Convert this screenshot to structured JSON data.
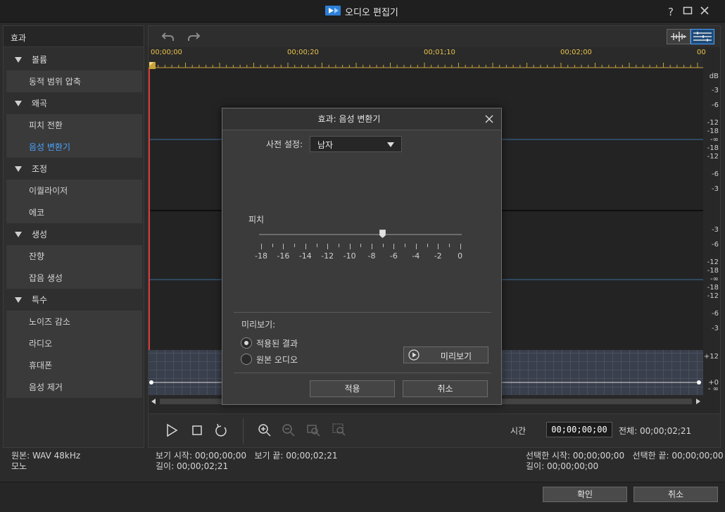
{
  "app": {
    "title": "오디오 편집기",
    "window_buttons": {
      "help": "?"
    }
  },
  "effects_panel": {
    "header": "효과",
    "categories": [
      {
        "label": "볼륨",
        "items": [
          "동적 범위 압축"
        ]
      },
      {
        "label": "왜곡",
        "items": [
          "피치 전환",
          "음성 변환기"
        ]
      },
      {
        "label": "조정",
        "items": [
          "이퀄라이저",
          "에코"
        ]
      },
      {
        "label": "생성",
        "items": [
          "잔향",
          "잡음 생성"
        ]
      },
      {
        "label": "특수",
        "items": [
          "노이즈 감소",
          "라디오",
          "휴대폰",
          "음성 제거"
        ]
      }
    ],
    "active_item": "음성 변환기"
  },
  "ruler": {
    "timecodes": [
      "00;00;00",
      "00;00;20",
      "00;01;10",
      "00;02;00",
      "00"
    ]
  },
  "db_scale": {
    "unit": "dB",
    "upper": [
      "-3",
      "-6",
      "-12",
      "-18",
      "-∞",
      "-18",
      "-12",
      "-6",
      "-3"
    ],
    "lower": [
      "-3",
      "-6",
      "-12",
      "-18",
      "-∞",
      "-18",
      "-12",
      "-6",
      "-3"
    ],
    "envelope": [
      "+12",
      "+0",
      "- ∞"
    ]
  },
  "transport": {
    "time_label": "시간",
    "time_value": "00;00;00;00",
    "total": "전체: 00;00;02;21"
  },
  "status": {
    "source": "원본: WAV 48kHz",
    "channel": "모노",
    "view_start": "보기 시작: 00;00;00;00",
    "view_end": "보기 끝: 00;00;02;21",
    "length": "길이: 00;00;02;21",
    "sel_start": "선택한 시작: 00;00;00;00",
    "sel_end": "선택한 끝: 00;00;00;00",
    "sel_length": "길이: 00;00;00;00"
  },
  "bottom": {
    "ok": "확인",
    "cancel": "취소"
  },
  "dialog": {
    "title": "효과: 음성 변환기",
    "preset_label": "사전 설정:",
    "preset_value": "남자",
    "pitch_label": "피치",
    "pitch_ticks": [
      "-18",
      "-16",
      "-14",
      "-12",
      "-10",
      "-8",
      "-6",
      "-4",
      "-2",
      "0"
    ],
    "pitch_value": -7,
    "pitch_min": -18,
    "pitch_max": 0,
    "preview_label": "미리보기:",
    "radio_applied": "적용된 결과",
    "radio_original": "원본 오디오",
    "preview_button": "미리보기",
    "apply": "적용",
    "cancel": "취소"
  },
  "colors": {
    "accent": "#4aa3ff",
    "timecode": "#e8c24a",
    "playhead": "#d93a3a"
  }
}
